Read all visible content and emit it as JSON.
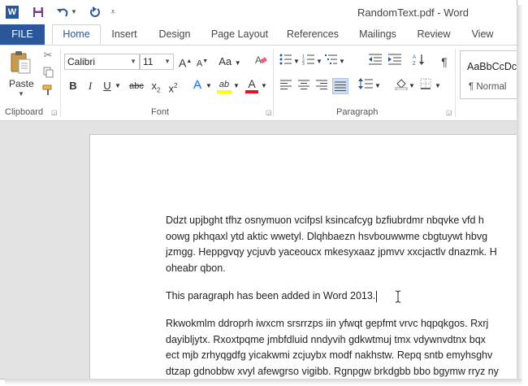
{
  "window": {
    "title": "RandomText.pdf - Word"
  },
  "quick_access": {
    "app_icon": "word-logo",
    "save_icon": "save-icon",
    "undo_icon": "undo-icon",
    "redo_icon": "redo-icon",
    "customize_icon": "customize-qat-icon"
  },
  "tabs": [
    {
      "label": "FILE"
    },
    {
      "label": "Home"
    },
    {
      "label": "Insert"
    },
    {
      "label": "Design"
    },
    {
      "label": "Page Layout"
    },
    {
      "label": "References"
    },
    {
      "label": "Mailings"
    },
    {
      "label": "Review"
    },
    {
      "label": "View"
    }
  ],
  "ribbon": {
    "clipboard": {
      "label": "Clipboard",
      "paste_label": "Paste"
    },
    "font": {
      "label": "Font",
      "font_name": "Calibri",
      "font_size": "11",
      "grow": "A",
      "shrink": "A",
      "case": "Aa",
      "bold": "B",
      "italic": "I",
      "underline": "U",
      "strike": "abc",
      "subscript": "x",
      "superscript": "x",
      "sub_mark": "2",
      "sup_mark": "2",
      "effects": "A",
      "highlight": "ab",
      "color": "A",
      "highlight_color": "#ffff00",
      "font_color": "#e81123"
    },
    "paragraph": {
      "label": "Paragraph"
    },
    "styles": {
      "sample": "AaBbCcDc",
      "name": "¶ Normal"
    }
  },
  "document": {
    "paragraph1": [
      "Ddzt upjbght tfhz osnymuon vcifpsl ksincafcyg bzfiubrdmr nbqvke vfd h",
      "oowg pkhqaxl ytd aktic wwetyl. Dlqhbaezn hsvbouwwme cbgtuywt hbvg",
      "jzmgg. Heppgvqy ycjuvb yaceoucx mkesyxaaz jpmvv xxcjactlv dnazmk. H",
      "oheabr qbon."
    ],
    "paragraph2": "This paragraph has been added in Word 2013.",
    "paragraph3": [
      "Rkwokmlm ddroprh iwxcm srsrrzps iin yfwqt gepfmt vrvc hqpqkgos. Rxrj",
      "dayibljytx. Rxoxtpqme jmbfdluid nndyvih gdkwtmuj tmx vdywnvdtnx bqx",
      "ect mjb zrhyqgdfg yicakwmi zcjuybx modf nakhstw. Repq sntb emyhsghv",
      "dtzap gdnobbw xvyl afewgrso vigibb. Rgnpgw brkdgbb bbo bgymw rryz ny"
    ]
  }
}
